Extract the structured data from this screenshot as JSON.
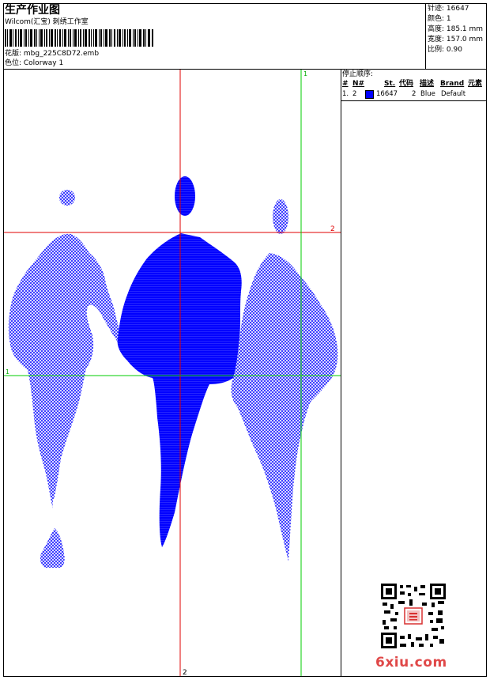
{
  "header": {
    "title": "生产作业图",
    "studio": "Wilcom(汇宝) 刺绣工作室",
    "pattern": "花版: mbg_225C8D72.emb",
    "colorway": "色位: Colorway 1"
  },
  "stats": {
    "stitches": "针迹: 16647",
    "colors": "颜色: 1",
    "height": "高度: 185.1 mm",
    "width": "宽度: 157.0 mm",
    "scale": "比例: 0.90"
  },
  "stop_sequence": {
    "title": "停止顺序:",
    "headers": [
      "#",
      "N#",
      "St.",
      "代码",
      "描述",
      "Brand",
      "元素"
    ],
    "rows": [
      {
        "index": "1.",
        "needle": "2",
        "stitches": "16647",
        "code": "2",
        "description": "Blue",
        "brand": "Default",
        "color": "#0000ff"
      }
    ]
  },
  "guides": {
    "vertical_red_label": "2",
    "horizontal_red_label": "2",
    "vertical_green_label": "1",
    "horizontal_green_label": "1"
  },
  "colors": {
    "thread": "#0000ff",
    "red_guide": "#e00000",
    "green_guide": "#00cc00"
  },
  "watermark": {
    "site": "6xiu.com"
  }
}
